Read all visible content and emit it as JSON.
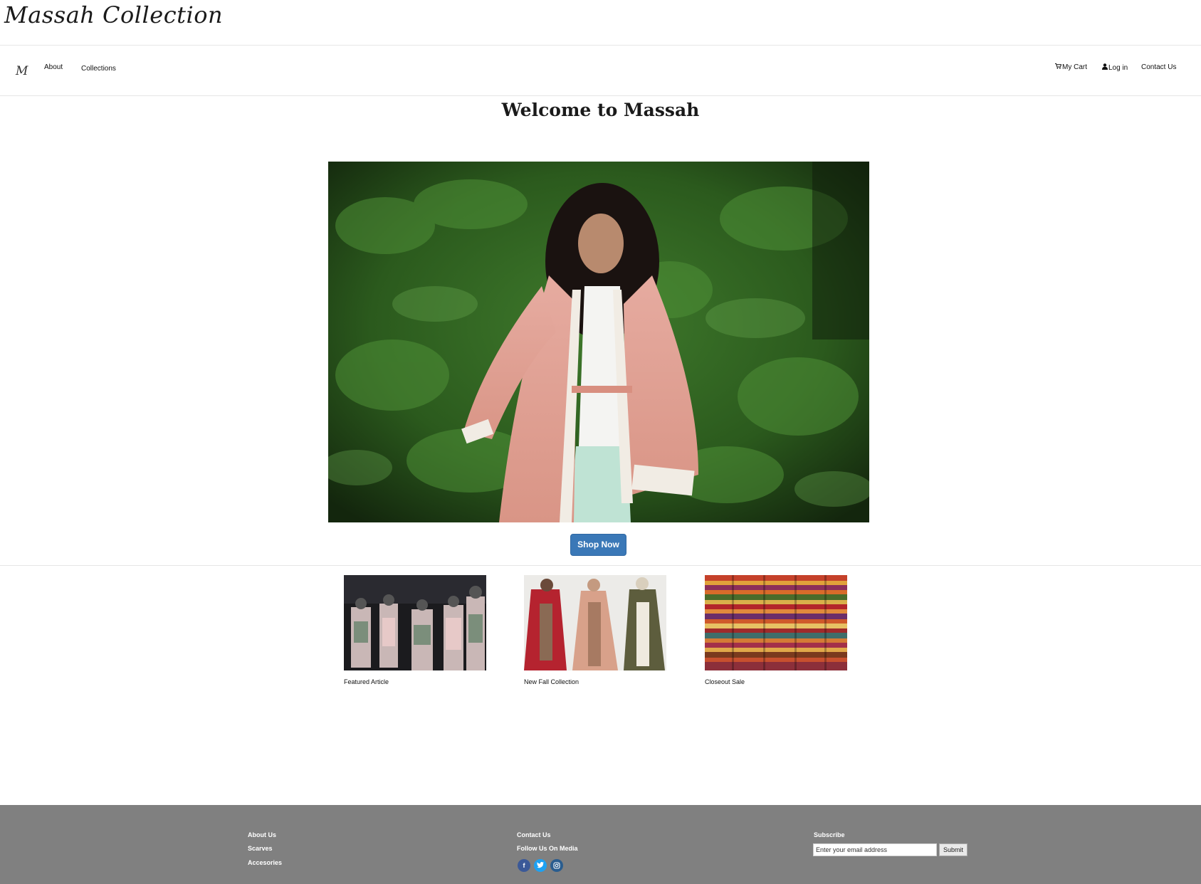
{
  "brand": {
    "name": "Massah Collection",
    "nav_logo": "M"
  },
  "nav": {
    "about": "About",
    "collections": "Collections",
    "cart": "My Cart",
    "login": "Log in",
    "contact": "Contact Us"
  },
  "hero": {
    "title": "Welcome to Massah",
    "cta": "Shop Now"
  },
  "cards": [
    {
      "caption": "Featured Article"
    },
    {
      "caption": "New Fall Collection"
    },
    {
      "caption": "Closeout Sale"
    }
  ],
  "footer": {
    "col1": [
      "About Us",
      "Scarves",
      "Accesories"
    ],
    "contact": "Contact Us",
    "follow": "Follow Us On Media",
    "subscribe": "Subscribe",
    "email_placeholder": "Enter your email address",
    "submit": "Submit"
  },
  "icons": [
    "cart-icon",
    "user-icon",
    "facebook-icon",
    "twitter-icon",
    "instagram-icon"
  ],
  "colors": {
    "button": "#3a78b7",
    "footer_bg": "#808080",
    "facebook": "#3b5998",
    "twitter": "#1da1f2",
    "instagram": "#2a5d8f"
  }
}
